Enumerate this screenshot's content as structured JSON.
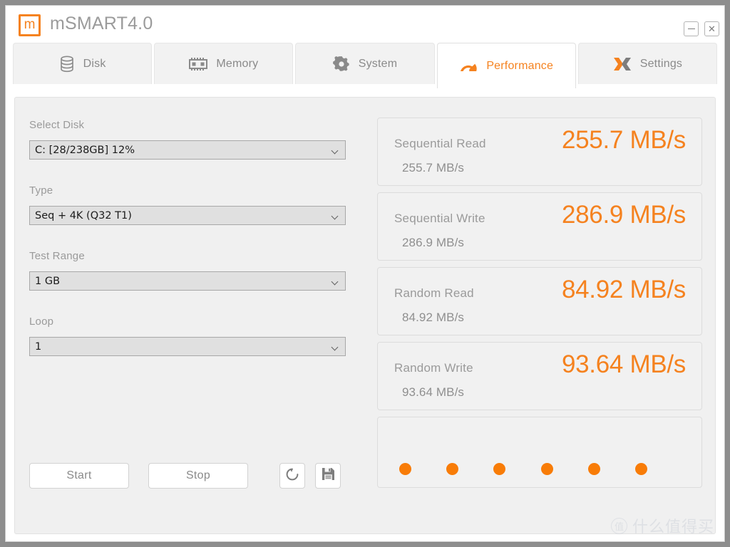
{
  "window": {
    "title": "mSMART4.0",
    "logo_letter": "m",
    "minimize_label": "–",
    "close_label": "✕"
  },
  "tabs": [
    {
      "id": "disk",
      "label": "Disk",
      "icon": "disk-icon",
      "active": false
    },
    {
      "id": "memory",
      "label": "Memory",
      "icon": "memory-icon",
      "active": false
    },
    {
      "id": "system",
      "label": "System",
      "icon": "gear-icon",
      "active": false
    },
    {
      "id": "performance",
      "label": "Performance",
      "icon": "speedometer-icon",
      "active": true
    },
    {
      "id": "settings",
      "label": "Settings",
      "icon": "x-cross-icon",
      "active": false
    }
  ],
  "form": {
    "select_disk": {
      "label": "Select Disk",
      "value": "C: [28/238GB] 12%"
    },
    "type": {
      "label": "Type",
      "value": "Seq + 4K (Q32 T1)"
    },
    "test_range": {
      "label": "Test Range",
      "value": "1 GB"
    },
    "loop": {
      "label": "Loop",
      "value": "1"
    }
  },
  "buttons": {
    "start": "Start",
    "stop": "Stop",
    "refresh_icon": "refresh-icon",
    "save_icon": "save-icon"
  },
  "results": [
    {
      "name": "Sequential Read",
      "value": "255.7 MB/s",
      "detail": "255.7 MB/s"
    },
    {
      "name": "Sequential Write",
      "value": "286.9 MB/s",
      "detail": "286.9 MB/s"
    },
    {
      "name": "Random Read",
      "value": "84.92 MB/s",
      "detail": "84.92 MB/s"
    },
    {
      "name": "Random Write",
      "value": "93.64 MB/s",
      "detail": "93.64 MB/s"
    }
  ],
  "progress": {
    "dot_count": 6,
    "dot_color": "#f87c07"
  },
  "watermark": {
    "badge": "值",
    "text": "什么值得买"
  },
  "colors": {
    "accent": "#f5821f",
    "content_bg": "#f0f0f0",
    "card_bg": "#f1f1f1",
    "text_muted": "#9a9a9a"
  }
}
